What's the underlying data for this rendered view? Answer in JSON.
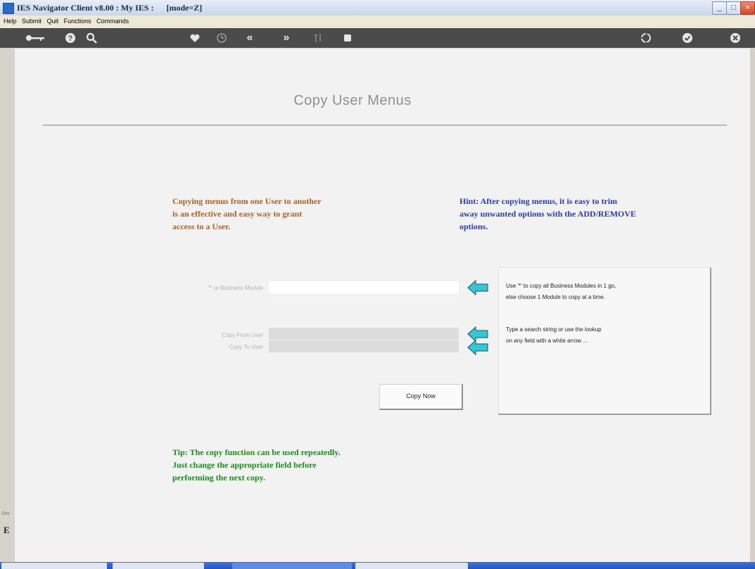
{
  "window": {
    "title": "IES Navigator Client v8.00 : My IES :      [mode=Z]"
  },
  "menu": [
    "Help",
    "Submit",
    "Quit",
    "Functions",
    "Commands"
  ],
  "toolbar": {
    "icons": [
      "key-icon",
      "help-icon",
      "search-icon",
      "heart-icon",
      "clock-icon",
      "rewind-icon",
      "forward-icon",
      "sort-icon",
      "stop-icon",
      "recycle-icon",
      "check-icon",
      "close-icon"
    ],
    "rewind_glyph": "«",
    "forward_glyph": "»"
  },
  "page": {
    "title": "Copy User Menus"
  },
  "description": [
    "Copying menus from one User to another",
    "is an effective and easy way to grant",
    "access to a User."
  ],
  "hint": [
    "Hint: After copying menus, it is easy to trim",
    "away unwanted options with the ADD/REMOVE",
    "options."
  ],
  "form": {
    "business_module_label": "'*' or Business Module",
    "business_module_value": "",
    "copy_from_label": "Copy From User",
    "copy_from_value": "",
    "copy_to_label": "Copy To User",
    "copy_to_value": ""
  },
  "info": [
    "Use '*' to copy all Business Modules in 1 go,",
    "else choose 1 Module to copy at a time.",
    "Type a search string or use the lookup",
    "on any field with a white arrow ..."
  ],
  "button": {
    "copy_now": "Copy Now"
  },
  "tip": [
    "Tip: The copy function can be used repeatedly.",
    "Just change the appropriate field before",
    "performing the next copy."
  ],
  "sidebar": {
    "small_label": "Sec",
    "big_label": "E"
  },
  "colors": {
    "description": "#b2601c",
    "hint": "#2a3bbf",
    "tip": "#1e8a1e",
    "arrow": "#36c6d6",
    "toolbar": "#4b4b4b"
  }
}
